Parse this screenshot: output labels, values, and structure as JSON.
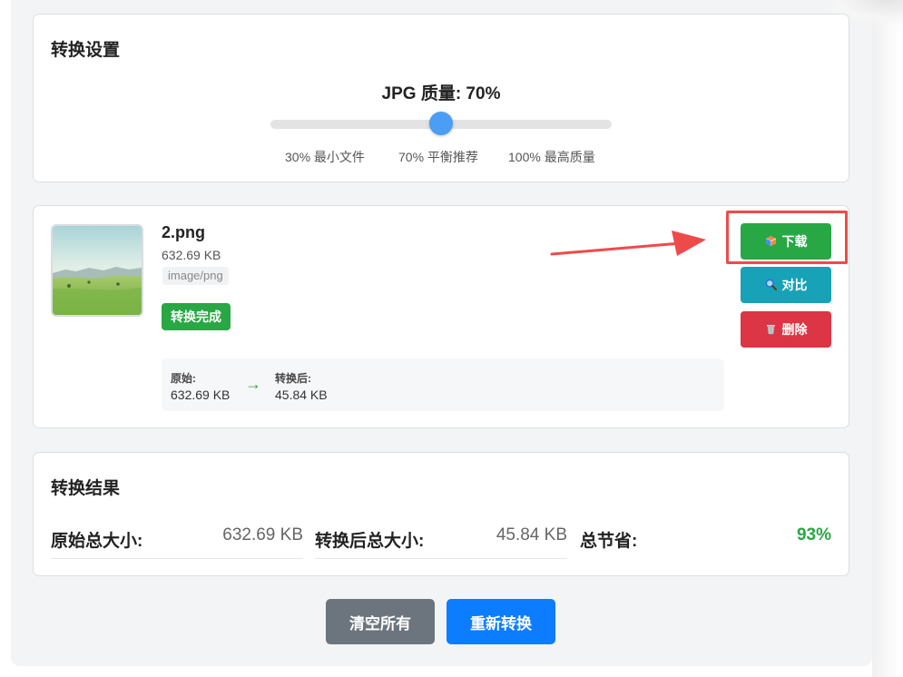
{
  "settings": {
    "title": "转换设置",
    "quality_label": "JPG 质量: 70%",
    "quality_value": 70,
    "ticks": [
      "30% 最小文件",
      "70% 平衡推荐",
      "100% 最高质量"
    ]
  },
  "file": {
    "name": "2.png",
    "size": "632.69 KB",
    "type": "image/png",
    "status": "转换完成",
    "original_label": "原始:",
    "original_value": "632.69 KB",
    "arrow": "→",
    "converted_label": "转换后:",
    "converted_value": "45.84 KB",
    "actions": {
      "download": "下载",
      "compare": "对比",
      "delete": "删除"
    },
    "icons": {
      "download": "package-icon",
      "compare": "magnifier-icon",
      "delete": "trash-icon"
    }
  },
  "result": {
    "title": "转换结果",
    "original_total_label": "原始总大小:",
    "original_total_value": "632.69 KB",
    "converted_total_label": "转换后总大小:",
    "converted_total_value": "45.84 KB",
    "saved_label": "总节省:",
    "saved_value": "93%"
  },
  "buttons": {
    "clear_all": "清空所有",
    "reconvert": "重新转换"
  },
  "colors": {
    "success": "#28a745",
    "info": "#17a2b8",
    "danger": "#dc3545",
    "primary": "#0d7dff",
    "secondary": "#6c757d",
    "slider_thumb": "#4b9df5",
    "annotation": "#ef4a4a"
  }
}
